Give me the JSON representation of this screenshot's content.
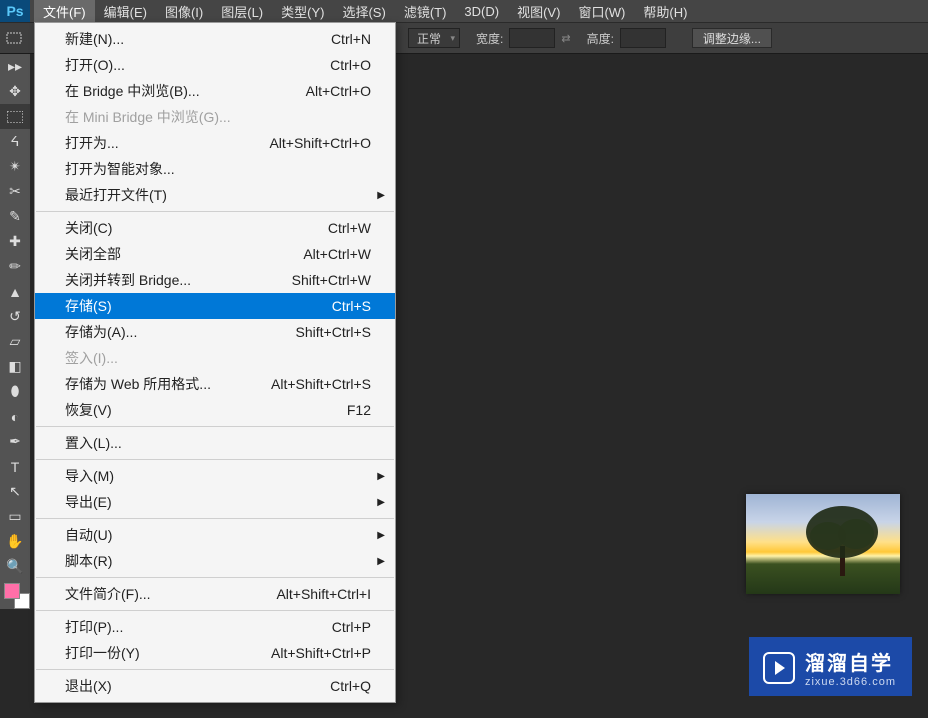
{
  "menubar": {
    "items": [
      {
        "label": "文件(F)"
      },
      {
        "label": "编辑(E)"
      },
      {
        "label": "图像(I)"
      },
      {
        "label": "图层(L)"
      },
      {
        "label": "类型(Y)"
      },
      {
        "label": "选择(S)"
      },
      {
        "label": "滤镜(T)"
      },
      {
        "label": "3D(D)"
      },
      {
        "label": "视图(V)"
      },
      {
        "label": "窗口(W)"
      },
      {
        "label": "帮助(H)"
      }
    ]
  },
  "options": {
    "mode_value": "正常",
    "width_label": "宽度:",
    "height_label": "高度:",
    "edge_label": "调整边缘..."
  },
  "file_menu": {
    "groups": [
      [
        {
          "label": "新建(N)...",
          "shortcut": "Ctrl+N"
        },
        {
          "label": "打开(O)...",
          "shortcut": "Ctrl+O"
        },
        {
          "label": "在 Bridge 中浏览(B)...",
          "shortcut": "Alt+Ctrl+O"
        },
        {
          "label": "在 Mini Bridge 中浏览(G)...",
          "shortcut": "",
          "disabled": true
        },
        {
          "label": "打开为...",
          "shortcut": "Alt+Shift+Ctrl+O"
        },
        {
          "label": "打开为智能对象...",
          "shortcut": ""
        },
        {
          "label": "最近打开文件(T)",
          "shortcut": "",
          "submenu": true
        }
      ],
      [
        {
          "label": "关闭(C)",
          "shortcut": "Ctrl+W"
        },
        {
          "label": "关闭全部",
          "shortcut": "Alt+Ctrl+W"
        },
        {
          "label": "关闭并转到 Bridge...",
          "shortcut": "Shift+Ctrl+W"
        },
        {
          "label": "存储(S)",
          "shortcut": "Ctrl+S",
          "highlighted": true
        },
        {
          "label": "存储为(A)...",
          "shortcut": "Shift+Ctrl+S"
        },
        {
          "label": "签入(I)...",
          "shortcut": "",
          "disabled": true
        },
        {
          "label": "存储为 Web 所用格式...",
          "shortcut": "Alt+Shift+Ctrl+S"
        },
        {
          "label": "恢复(V)",
          "shortcut": "F12"
        }
      ],
      [
        {
          "label": "置入(L)...",
          "shortcut": ""
        }
      ],
      [
        {
          "label": "导入(M)",
          "shortcut": "",
          "submenu": true
        },
        {
          "label": "导出(E)",
          "shortcut": "",
          "submenu": true
        }
      ],
      [
        {
          "label": "自动(U)",
          "shortcut": "",
          "submenu": true
        },
        {
          "label": "脚本(R)",
          "shortcut": "",
          "submenu": true
        }
      ],
      [
        {
          "label": "文件简介(F)...",
          "shortcut": "Alt+Shift+Ctrl+I"
        }
      ],
      [
        {
          "label": "打印(P)...",
          "shortcut": "Ctrl+P"
        },
        {
          "label": "打印一份(Y)",
          "shortcut": "Alt+Shift+Ctrl+P"
        }
      ],
      [
        {
          "label": "退出(X)",
          "shortcut": "Ctrl+Q"
        }
      ]
    ]
  },
  "watermark": {
    "main": "溜溜自学",
    "sub": "zixue.3d66.com"
  }
}
